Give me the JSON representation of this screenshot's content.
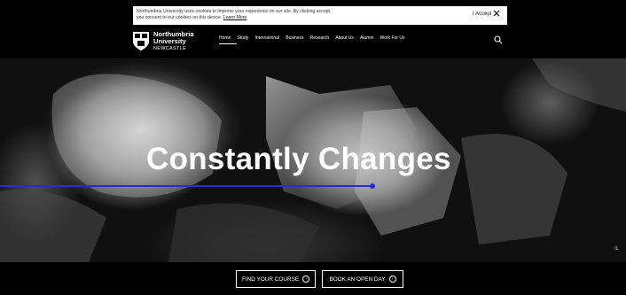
{
  "cookie_banner": {
    "line1": "Northumbria University uses cookies to improve your experience on our site. By clicking accept",
    "line2": "you consent to our cookies on this device.",
    "learn_more": "Learn More",
    "accept_label": "I Accept"
  },
  "header": {
    "logo_line1": "Northumbria",
    "logo_line2": "University",
    "logo_sub": "NEWCASTLE",
    "nav": [
      "Home",
      "Study",
      "International",
      "Business",
      "Research",
      "About Us",
      "Alumni",
      "Work For Us"
    ]
  },
  "hero": {
    "headline": "Constantly Changes",
    "side_label": "IL"
  },
  "cta": {
    "find_course": "FIND YOUR COURSE",
    "open_day": "BOOK AN OPEN DAY"
  }
}
